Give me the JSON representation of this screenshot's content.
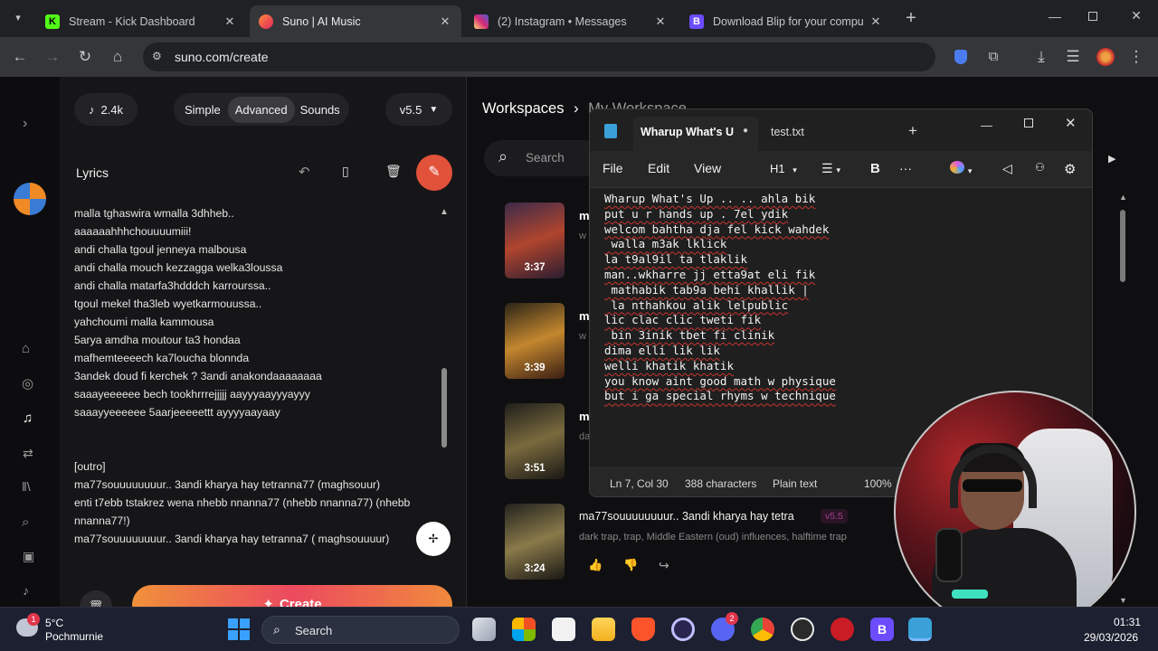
{
  "browser": {
    "tabs": [
      {
        "title": "Stream - Kick Dashboard",
        "color": "#53fc18"
      },
      {
        "title": "Suno | AI Music",
        "color": "#ff5a36"
      },
      {
        "title": "(2) Instagram • Messages",
        "color": "#d62976"
      },
      {
        "title": "Download Blip for your comput",
        "color": "#6b4cff"
      }
    ],
    "url": "suno.com/create"
  },
  "suno": {
    "credits": "2.4k",
    "modes": [
      "Simple",
      "Advanced",
      "Sounds"
    ],
    "version": "v5.5",
    "lyrics_label": "Lyrics",
    "lyrics_lines": [
      "malla tghaswira wmalla 3dhheb..",
      "aaaaaahhhchouuuumiii!",
      "andi challa tgoul jenneya malbousa",
      "andi challa mouch kezzagga welka3loussa",
      "andi challa matarfa3hdddch karrourssa..",
      "tgoul mekel tha3leb wyetkarmouussa..",
      "yahchoumi malla kammousa",
      "5arya amdha moutour ta3 hondaa",
      "mafhemteeeech ka7loucha blonnda",
      "3andek doud fi kerchek ? 3andi anakondaaaaaaaa",
      "saaayeeeeee bech tookhrrrejjjjj aayyyaayyyayyy",
      "saaayyeeeeee 5aarjeeeeettt ayyyyaayaay",
      "",
      "",
      "[outro]",
      "ma77souuuuuuuur.. 3andi kharya hay tetranna77 (maghsouur)",
      "enti t7ebb tstakrez wena nhebb nnanna77 (nhebb nnanna77) (nhebb",
      "nnanna77!)",
      "ma77souuuuuuuur.. 3andi kharya hay tetranna7 ( maghsouuuur)"
    ],
    "create_label": "Create",
    "breadcrumb": [
      "Workspaces",
      "My Workspace"
    ],
    "search_placeholder": "Search",
    "songs": [
      {
        "duration": "3:37",
        "title": "m",
        "tags": "w"
      },
      {
        "duration": "3:39",
        "title": "m",
        "tags": "w"
      },
      {
        "duration": "3:51",
        "title": "m",
        "tags": "da"
      },
      {
        "duration": "3:24",
        "title": "ma77souuuuuuuur.. 3andi kharya hay tetra",
        "version": "v5.5",
        "tags": "dark trap, trap, Middle Eastern (oud) influences, halftime trap"
      }
    ]
  },
  "notepad": {
    "tabs": [
      "Wharup What's U",
      "test.txt"
    ],
    "menu": [
      "File",
      "Edit",
      "View"
    ],
    "heading_select": "H1",
    "lines": [
      "Wharup What's Up .. .. ahla bik",
      "put u r hands up . 7el ydik",
      "welcom bahtha dja fel kick wahdek",
      " walla m3ak lklick",
      "la t9al9il ta tlaklik",
      "man..wkharre jj etta9at eli fik",
      " mathabik tab9a behi khallik |",
      " la nthahkou alik lelpublic",
      "lic clac clic tweti fik",
      " bin 3inik tbet fi clinik",
      "dima elli lik lik",
      "welli khatik khatik",
      "you know aint good math w physique",
      "but i ga special rhyms w technique"
    ],
    "status": {
      "position": "Ln 7, Col 30",
      "chars": "388 characters",
      "format": "Plain text",
      "zoom": "100%"
    }
  },
  "taskbar": {
    "weather_temp": "5°C",
    "weather_place": "Pochmurnie",
    "weather_badge": "1",
    "search": "Search",
    "time": "01:31",
    "date": "29/03/2026",
    "discord_badge": "2"
  }
}
